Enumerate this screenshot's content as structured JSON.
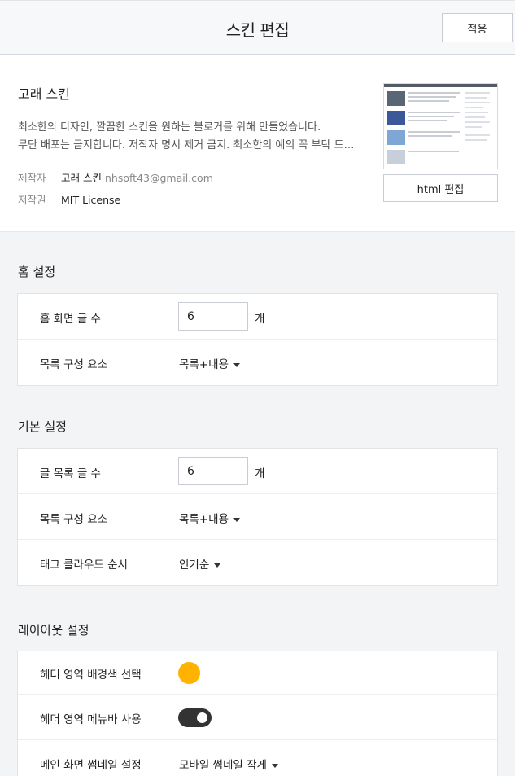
{
  "header": {
    "title": "스킨 편집",
    "apply_label": "적용"
  },
  "skin": {
    "name": "고래 스킨",
    "description_lines": [
      "최소한의 디자인, 깔끔한 스킨을 원하는 블로거를 위해 만들었습니다.",
      "무단 배포는 금지합니다. 저작자 명시 제거 금지. 최소한의 예의 꼭 부탁 드…"
    ],
    "author_label": "제작자",
    "author_name": "고래 스킨",
    "author_email": "nhsoft43@gmail.com",
    "license_label": "저작권",
    "license_value": "MIT License",
    "html_edit_label": "html 편집"
  },
  "home_settings": {
    "title": "홈 설정",
    "posts_label": "홈 화면 글 수",
    "posts_value": "6",
    "posts_unit": "개",
    "list_label": "목록 구성 요소",
    "list_value": "목록+내용"
  },
  "basic_settings": {
    "title": "기본 설정",
    "posts_label": "글 목록 글 수",
    "posts_value": "6",
    "posts_unit": "개",
    "list_label": "목록 구성 요소",
    "list_value": "목록+내용",
    "tag_label": "태그 클라우드 순서",
    "tag_value": "인기순"
  },
  "layout_settings": {
    "title": "레이아웃 설정",
    "header_bg_label": "헤더 영역 배경색 선택",
    "header_bg_color": "#FFB300",
    "menubar_label": "헤더 영역 메뉴바 사용",
    "menubar_enabled": true,
    "thumb_label": "메인 화면 썸네일 설정",
    "thumb_value": "모바일 썸네일 작게"
  },
  "colors": {
    "accent_yellow": "#FFB300",
    "toggle_on": "#333333",
    "thumb_blue": "#3b5998",
    "thumb_sky": "#7fa7d6"
  }
}
